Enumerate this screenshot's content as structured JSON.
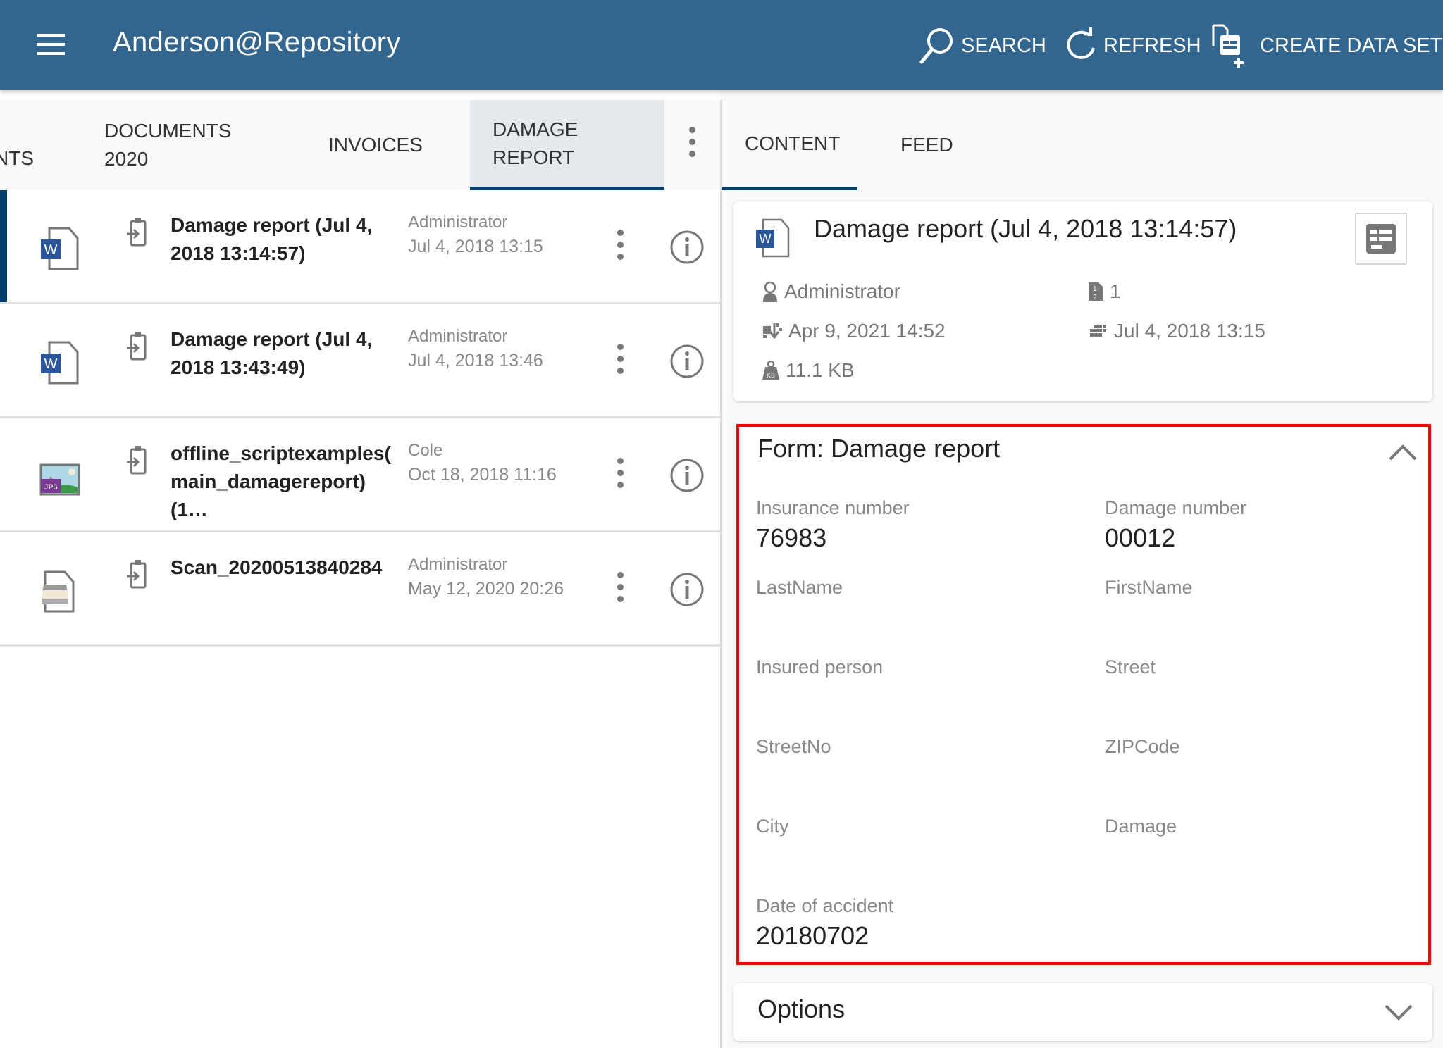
{
  "header": {
    "title": "Anderson@Repository",
    "search_label": "SEARCH",
    "refresh_label": "REFRESH",
    "create_label": "CREATE DATA SET"
  },
  "left_tabs": [
    {
      "label": "NTS"
    },
    {
      "label": "DOCUMENTS 2020"
    },
    {
      "label": "INVOICES"
    },
    {
      "label": "DAMAGE REPORT",
      "active": true
    }
  ],
  "list": [
    {
      "name": "Damage report (Jul 4, 2018 13:14:57)",
      "owner": "Administrator",
      "date": "Jul 4, 2018 13:15",
      "type": "word",
      "selected": true
    },
    {
      "name": "Damage report (Jul 4, 2018 13:43:49)",
      "owner": "Administrator",
      "date": "Jul 4, 2018 13:46",
      "type": "word"
    },
    {
      "name": "offline_scriptexamples( main_damagereport) (1…",
      "owner": "Cole",
      "date": "Oct 18, 2018 11:16",
      "type": "jpg",
      "badge": "JPG"
    },
    {
      "name": "Scan_20200513840284",
      "owner": "Administrator",
      "date": "May 12, 2020 20:26",
      "type": "scan"
    }
  ],
  "right_tabs": [
    {
      "label": "CONTENT",
      "active": true
    },
    {
      "label": "FEED"
    }
  ],
  "document": {
    "title": "Damage report (Jul 4, 2018 13:14:57)",
    "owner": "Administrator",
    "pages": "1",
    "modified": "Apr 9, 2021 14:52",
    "created": "Jul 4, 2018 13:15",
    "size": "11.1 KB"
  },
  "form": {
    "title": "Form: Damage report",
    "fields": [
      {
        "label": "Insurance number",
        "value": "76983"
      },
      {
        "label": "Damage number",
        "value": "00012"
      },
      {
        "label": "LastName",
        "value": ""
      },
      {
        "label": "FirstName",
        "value": ""
      },
      {
        "label": "Insured person",
        "value": ""
      },
      {
        "label": "Street",
        "value": ""
      },
      {
        "label": "StreetNo",
        "value": ""
      },
      {
        "label": "ZIPCode",
        "value": ""
      },
      {
        "label": "City",
        "value": ""
      },
      {
        "label": "Damage",
        "value": ""
      },
      {
        "label": "Date of accident",
        "value": "20180702"
      }
    ]
  },
  "options": {
    "title": "Options"
  },
  "colors": {
    "header": "#33668e",
    "accent": "#00406e",
    "highlight": "#ff0000",
    "word_blue": "#2b579a"
  }
}
